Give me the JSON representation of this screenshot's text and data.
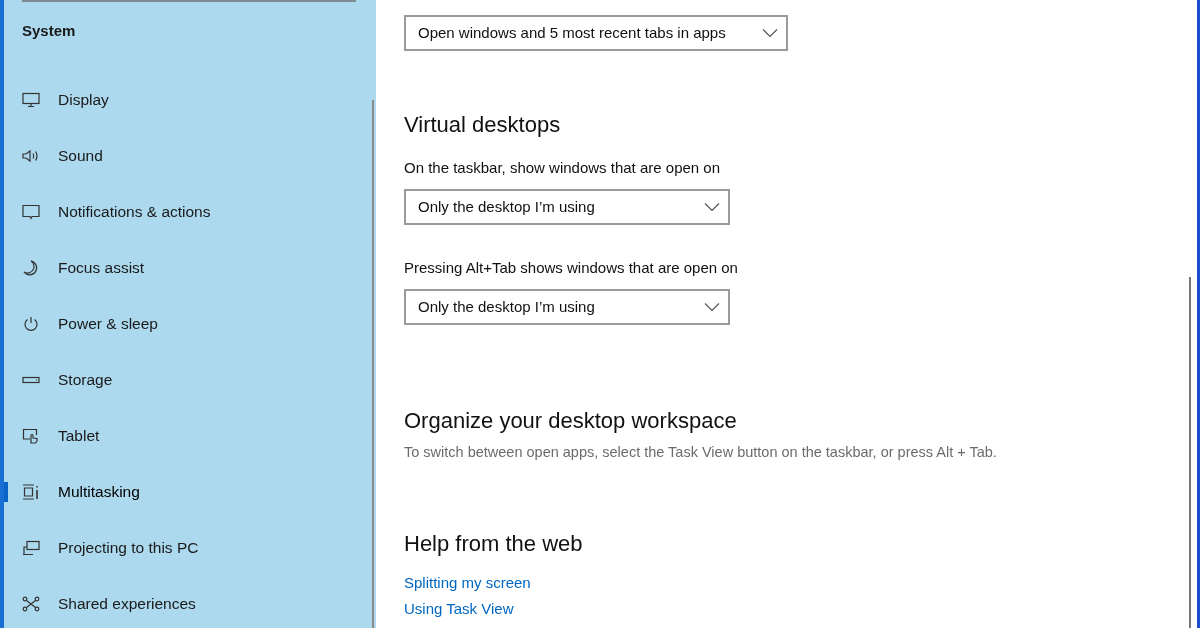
{
  "sidebar": {
    "heading": "System",
    "items": [
      {
        "label": "Display",
        "selected": false
      },
      {
        "label": "Sound",
        "selected": false
      },
      {
        "label": "Notifications & actions",
        "selected": false
      },
      {
        "label": "Focus assist",
        "selected": false
      },
      {
        "label": "Power & sleep",
        "selected": false
      },
      {
        "label": "Storage",
        "selected": false
      },
      {
        "label": "Tablet",
        "selected": false
      },
      {
        "label": "Multitasking",
        "selected": true
      },
      {
        "label": "Projecting to this PC",
        "selected": false
      },
      {
        "label": "Shared experiences",
        "selected": false
      }
    ]
  },
  "content": {
    "alt_tab_dropdown": {
      "value": "Open windows and 5 most recent tabs in apps"
    },
    "virtual_desktops": {
      "title": "Virtual desktops",
      "settings": [
        {
          "label": "On the taskbar, show windows that are open on",
          "value": "Only the desktop I’m using"
        },
        {
          "label": "Pressing Alt+Tab shows windows that are open on",
          "value": "Only the desktop I’m using"
        }
      ]
    },
    "organize": {
      "title": "Organize your desktop workspace",
      "description": "To switch between open apps, select the Task View button on the taskbar, or press Alt + Tab."
    },
    "help": {
      "title": "Help from the web",
      "links": [
        "Splitting my screen",
        "Using Task View"
      ]
    }
  }
}
